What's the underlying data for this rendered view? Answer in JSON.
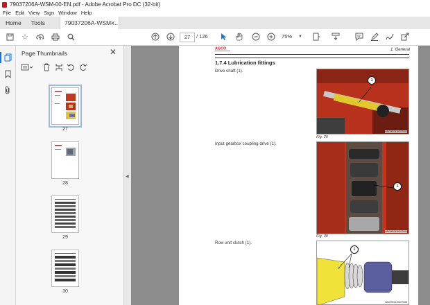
{
  "window": {
    "title": "79037206A-WSM-00-EN.pdf - Adobe Acrobat Pro DC (32-bit)"
  },
  "menu": [
    "File",
    "Edit",
    "View",
    "Sign",
    "Window",
    "Help"
  ],
  "tabs": {
    "home": "Home",
    "tools": "Tools",
    "document": "79037206A-WSM-..."
  },
  "toolbar": {
    "current_page": "27",
    "page_total": "/ 126",
    "zoom": "75%"
  },
  "panel": {
    "title": "Page Thumbnails",
    "thumbnails": [
      {
        "label": "27",
        "selected": true
      },
      {
        "label": "28",
        "selected": false
      },
      {
        "label": "29",
        "selected": false
      },
      {
        "label": "30",
        "selected": false
      }
    ]
  },
  "page": {
    "logo_text": "AGCO",
    "header_section": "1. General",
    "section_title": "1.7.4  Lubrication fittings",
    "items": [
      {
        "text": "Drive shaft (1).",
        "caption": "Fig. 29",
        "code": "HAGHE011020T001",
        "callout": "1"
      },
      {
        "text": "Input gearbox coupling drive (1).",
        "caption": "Fig. 30",
        "code": "HAGHE011020T001",
        "callout": "1"
      },
      {
        "text": "Row unit clutch (1).",
        "caption": "",
        "code": "HAGHE011020T002",
        "callout": "1"
      }
    ]
  },
  "colors": {
    "accent": "#1473e6",
    "brand_red": "#c8161e",
    "canvas_bg": "#8c8c8c"
  }
}
